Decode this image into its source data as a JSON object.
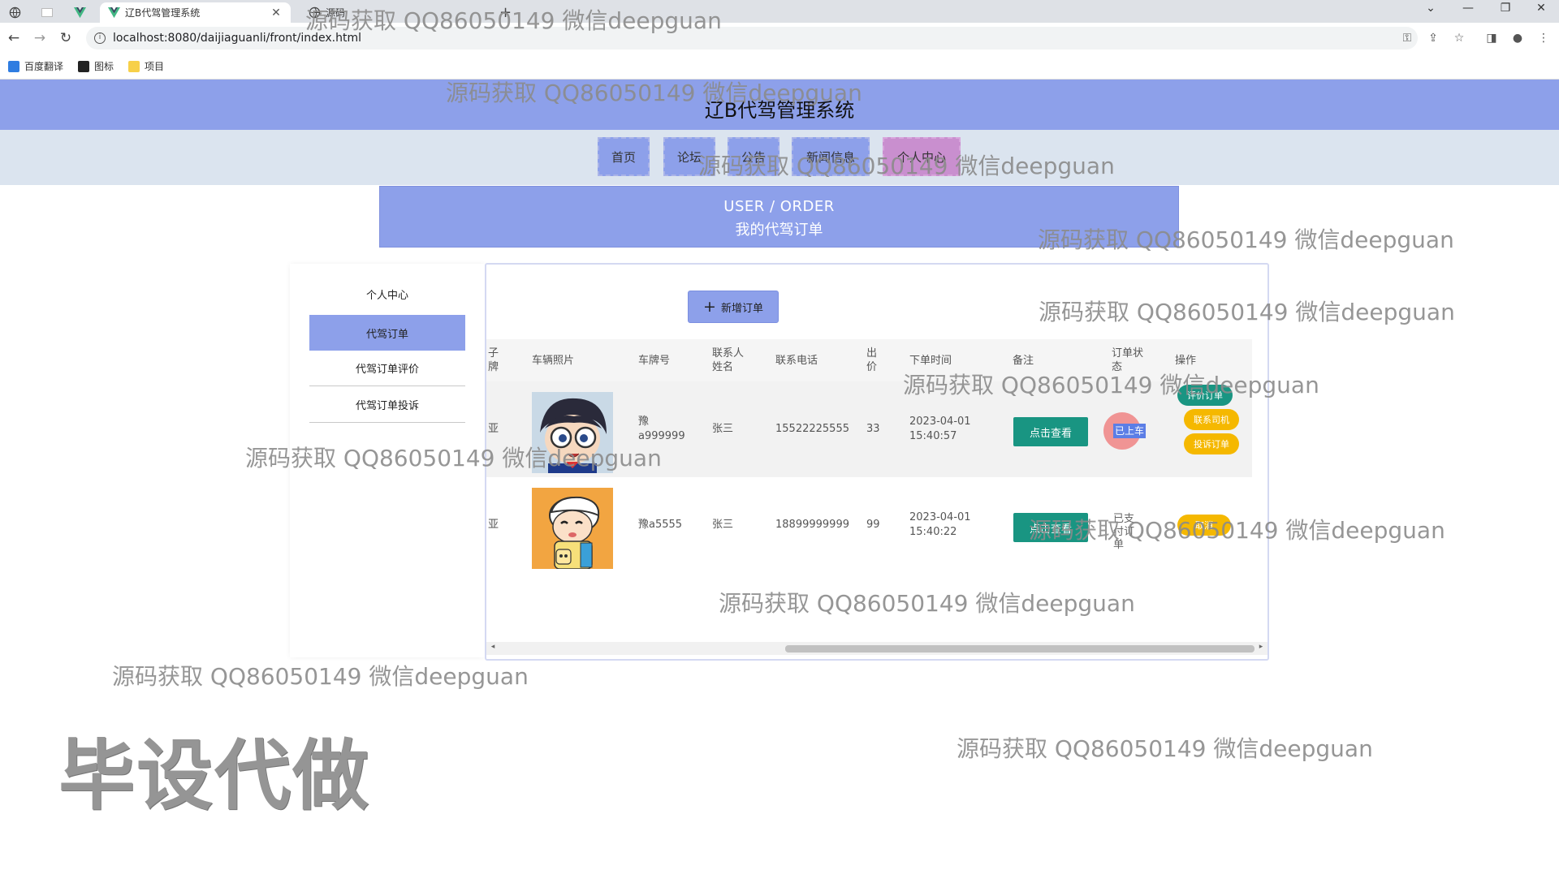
{
  "browser": {
    "active_tab_title": "辽B代驾管理系统",
    "second_tab_title": "源码",
    "url": "localhost:8080/daijiaguanli/front/index.html",
    "bookmarks": [
      "百度翻译",
      "图标",
      "项目"
    ]
  },
  "site": {
    "title": "辽B代驾管理系统",
    "nav": [
      "首页",
      "论坛",
      "公告",
      "新闻信息",
      "个人中心"
    ],
    "active_nav": "个人中心"
  },
  "banner": {
    "en": "USER / ORDER",
    "cn": "我的代驾订单"
  },
  "sidebar": {
    "items": [
      "个人中心",
      "代驾订单",
      "代驾订单评价",
      "代驾订单投诉"
    ],
    "active": "代驾订单"
  },
  "toolbar": {
    "add_label": "新增订单"
  },
  "table": {
    "headers": [
      "子牌",
      "车辆照片",
      "车牌号",
      "联系人姓名",
      "联系电话",
      "出价",
      "下单时间",
      "备注",
      "订单状态",
      "操作"
    ],
    "rows": [
      {
        "brand": "亚",
        "photo": "detective-cartoon-avatar",
        "plate": "豫a999999",
        "contact": "张三",
        "phone": "15522225555",
        "price": "33",
        "date": "2023-04-01",
        "time": "15:40:57",
        "note_button": "点击查看",
        "status": "已上车",
        "actions": [
          "评价订单",
          "联系司机",
          "投诉订单"
        ]
      },
      {
        "brand": "亚",
        "photo": "boy-cartoon-avatar",
        "plate": "豫a5555",
        "contact": "张三",
        "phone": "18899999999",
        "price": "99",
        "date": "2023-04-01",
        "time": "15:40:22",
        "note_button": "点击查看",
        "status": "已支付订单",
        "actions": [
          "取消"
        ]
      }
    ]
  },
  "watermark_text": "源码获取 QQ86050149 微信deepguan",
  "big_watermark": "毕设代做",
  "colors": {
    "header_bg": "#8da0ea",
    "nav_strip_bg": "#dbe4ef",
    "active_nav": "#c98fcf",
    "teal": "#199582",
    "yellow": "#f5b800"
  }
}
